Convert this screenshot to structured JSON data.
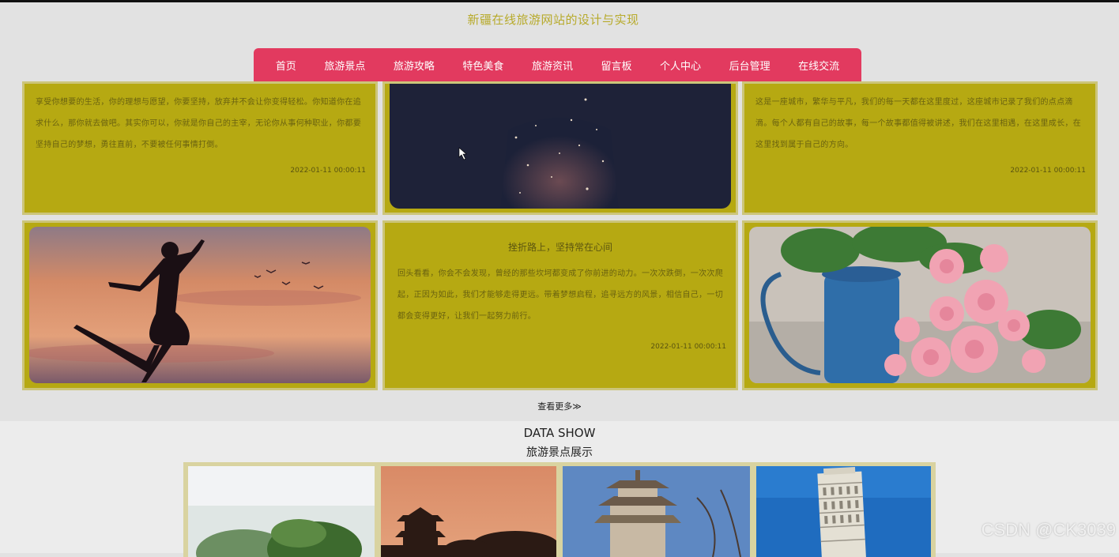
{
  "site": {
    "title": "新疆在线旅游网站的设计与实现"
  },
  "nav": {
    "items": [
      {
        "label": "首页",
        "name": "nav-home"
      },
      {
        "label": "旅游景点",
        "name": "nav-attractions"
      },
      {
        "label": "旅游攻略",
        "name": "nav-guides"
      },
      {
        "label": "特色美食",
        "name": "nav-food"
      },
      {
        "label": "旅游资讯",
        "name": "nav-news"
      },
      {
        "label": "留言板",
        "name": "nav-messages"
      },
      {
        "label": "个人中心",
        "name": "nav-profile"
      },
      {
        "label": "后台管理",
        "name": "nav-admin"
      },
      {
        "label": "在线交流",
        "name": "nav-chat"
      }
    ]
  },
  "articles": {
    "card1": {
      "text": "享受你想要的生活，你的理想与愿望，你要坚持，放弃并不会让你变得轻松。你知道你在追求什么，那你就去做吧。其实你可以，你就是你自己的主宰，无论你从事何种职业，你都要坚持自己的梦想，勇往直前，不要被任何事情打倒。",
      "date": "2022-01-11 00:00:11"
    },
    "card2": {
      "text": "这是一座城市，繁华与平凡，我们的每一天都在这里度过，这座城市记录了我们的点点滴滴。每个人都有自己的故事，每一个故事都值得被讲述，我们在这里相遇，在这里成长，在这里找到属于自己的方向。",
      "date": "2022-01-11 00:00:11"
    },
    "card3": {
      "heading": "挫折路上，坚持常在心间",
      "text": "回头看看，你会不会发现，曾经的那些坎坷都变成了你前进的动力。一次次跌倒，一次次爬起，正因为如此，我们才能够走得更远。带着梦想启程，追寻远方的风景，相信自己，一切都会变得更好，让我们一起努力前行。",
      "date": "2022-01-11 00:00:11"
    }
  },
  "more_link": {
    "label": "查看更多≫"
  },
  "gallery": {
    "title_en": "DATA SHOW",
    "title_cn": "旅游景点展示"
  },
  "watermark": "CSDN @CK3039",
  "colors": {
    "nav_bg": "#e23a5f",
    "card_bg": "#b6a912",
    "title_color": "#b7aa2a"
  }
}
